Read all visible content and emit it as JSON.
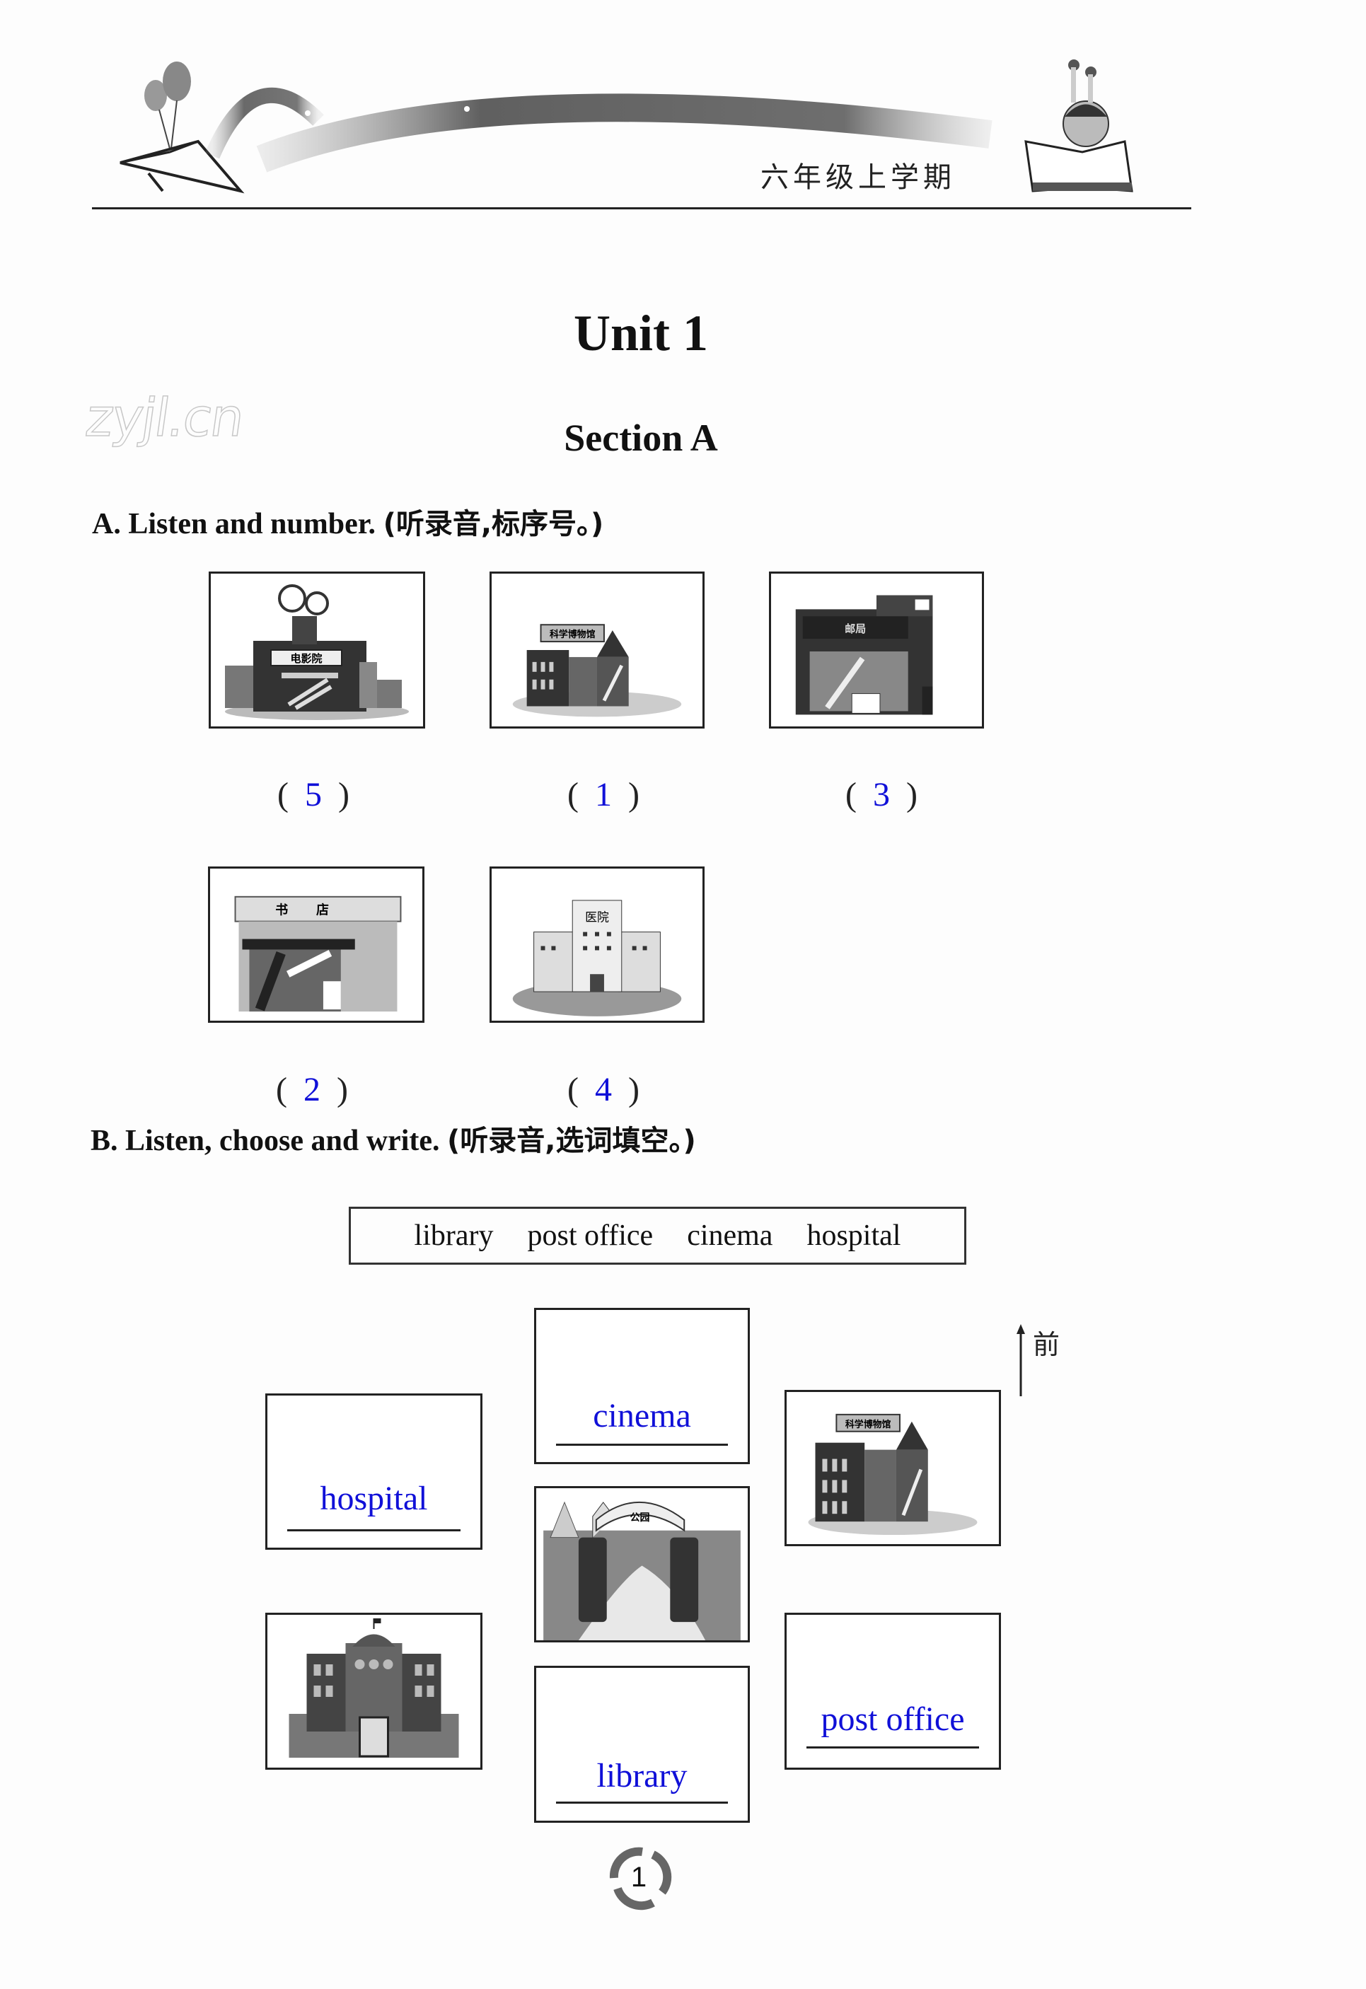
{
  "header": {
    "grade_label": "六年级上学期"
  },
  "watermark": "zyjl.cn",
  "unit_title": "Unit 1",
  "section_title": "Section A",
  "part_a": {
    "instruction_en": "A. Listen and number.",
    "instruction_cn": "(听录音,标序号。)",
    "items": [
      {
        "picture": "cinema",
        "sign": "电影院",
        "answer": "5"
      },
      {
        "picture": "science-museum",
        "sign": "科学博物馆",
        "answer": "1"
      },
      {
        "picture": "post-office",
        "sign": "邮局",
        "answer": "3"
      },
      {
        "picture": "bookstore",
        "sign": "书店",
        "answer": "2"
      },
      {
        "picture": "hospital",
        "sign": "医院",
        "answer": "4"
      }
    ],
    "paren_open": "(",
    "paren_close": ")"
  },
  "part_b": {
    "instruction_en": "B. Listen, choose and write.",
    "instruction_cn": "(听录音,选词填空。)",
    "word_bank": [
      "library",
      "post office",
      "cinema",
      "hospital"
    ],
    "map": {
      "cinema_box": "cinema",
      "hospital_box": "hospital",
      "library_box": "library",
      "post_office_box": "post office",
      "science_museum_sign": "科学博物馆",
      "park_sign": "公园"
    },
    "direction_label": "前"
  },
  "page_number": "1",
  "colors": {
    "answer_blue": "#1010d8",
    "ink": "#111111"
  }
}
